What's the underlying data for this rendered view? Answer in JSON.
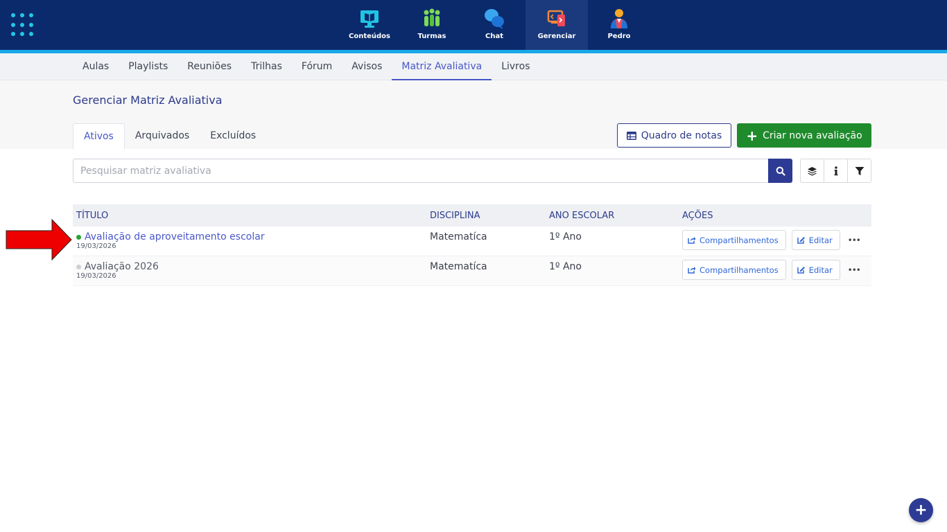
{
  "topnav": {
    "items": [
      {
        "label": "Conteúdos",
        "icon": "monitor-book-icon",
        "active": false
      },
      {
        "label": "Turmas",
        "icon": "people-group-icon",
        "active": false
      },
      {
        "label": "Chat",
        "icon": "chat-bubbles-icon",
        "active": false
      },
      {
        "label": "Gerenciar",
        "icon": "manage-devices-icon",
        "active": true
      },
      {
        "label": "Pedro",
        "icon": "user-avatar-icon",
        "active": false
      }
    ]
  },
  "subnav": {
    "items": [
      "Aulas",
      "Playlists",
      "Reuniões",
      "Trilhas",
      "Fórum",
      "Avisos",
      "Matriz Avaliativa",
      "Livros"
    ],
    "active": "Matriz Avaliativa"
  },
  "page": {
    "title": "Gerenciar Matriz Avaliativa",
    "tabs": [
      "Ativos",
      "Arquivados",
      "Excluídos"
    ],
    "active_tab": "Ativos",
    "quadro_label": "Quadro de notas",
    "criar_label": "Criar nova avaliação"
  },
  "search": {
    "placeholder": "Pesquisar matriz avaliativa"
  },
  "table": {
    "headers": {
      "titulo": "TÍTULO",
      "disciplina": "DISCIPLINA",
      "ano": "ANO ESCOLAR",
      "acoes": "AÇÕES"
    },
    "rows": [
      {
        "title": "Avaliação de aproveitamento escolar",
        "date": "19/03/2026",
        "disciplina": "Matematíca",
        "ano": "1º Ano",
        "status_color": "#2aa33a"
      },
      {
        "title": "Avaliação 2026",
        "date": "19/03/2026",
        "disciplina": "Matematíca",
        "ano": "1º Ano",
        "status_color": "#cfd1d6"
      }
    ],
    "share_label": "Compartilhamentos",
    "edit_label": "Editar",
    "more_label": "•••"
  },
  "fab": {
    "label": "+"
  },
  "colors": {
    "topbar": "#0a2a6b",
    "accent": "#4757c8",
    "primary_green": "#1f8b2c",
    "annotation_arrow": "#ee0000"
  }
}
